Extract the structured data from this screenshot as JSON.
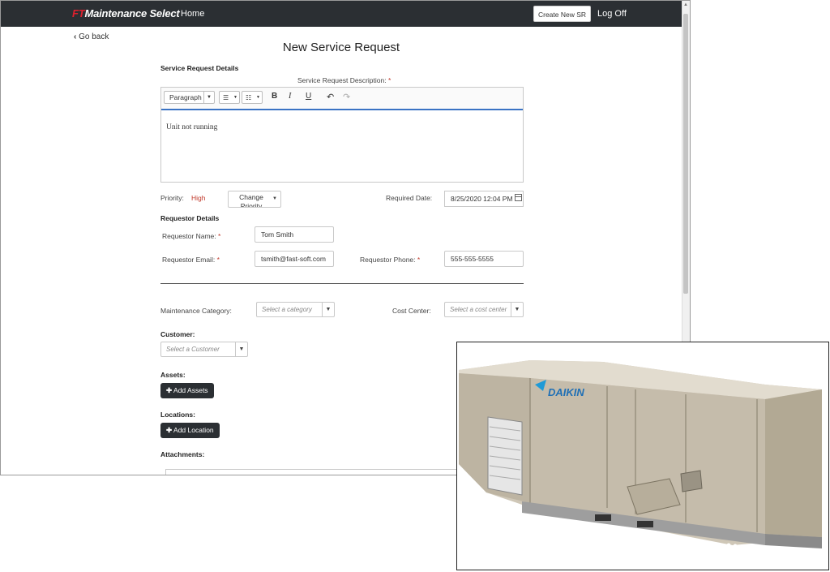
{
  "navbar": {
    "brand_prefix": "FT",
    "brand_name": "Maintenance Select",
    "home": "Home",
    "create_new_sr": "Create New SR",
    "log_off": "Log Off"
  },
  "go_back": "Go back",
  "page_title": "New Service Request",
  "service_request_details": {
    "heading": "Service Request Details",
    "description_label": "Service Request Description:",
    "required_marker": "*",
    "toolbar": {
      "format": "Paragraph",
      "bold": "B",
      "italic": "I",
      "underline": "U"
    },
    "description_value": "Unit not running"
  },
  "priority": {
    "label": "Priority:",
    "value": "High",
    "change_button": "Change Priority"
  },
  "required_date": {
    "label": "Required Date:",
    "value": "8/25/2020 12:04 PM"
  },
  "requestor_details": {
    "heading": "Requestor Details",
    "name_label": "Requestor Name:",
    "name_value": "Tom Smith",
    "email_label": "Requestor Email:",
    "email_value": "tsmith@fast-soft.com",
    "phone_label": "Requestor Phone:",
    "phone_value": "555-555-5555"
  },
  "maintenance_category": {
    "label": "Maintenance Category:",
    "placeholder": "Select a category"
  },
  "cost_center": {
    "label": "Cost Center:",
    "placeholder": "Select a cost center"
  },
  "customer": {
    "label": "Customer:",
    "placeholder": "Select a Customer"
  },
  "assets": {
    "label": "Assets:",
    "button": "Add Assets"
  },
  "locations": {
    "label": "Locations:",
    "button": "Add Location"
  },
  "attachments": {
    "label": "Attachments:"
  },
  "photo": {
    "brand_text": "DAIKIN"
  }
}
